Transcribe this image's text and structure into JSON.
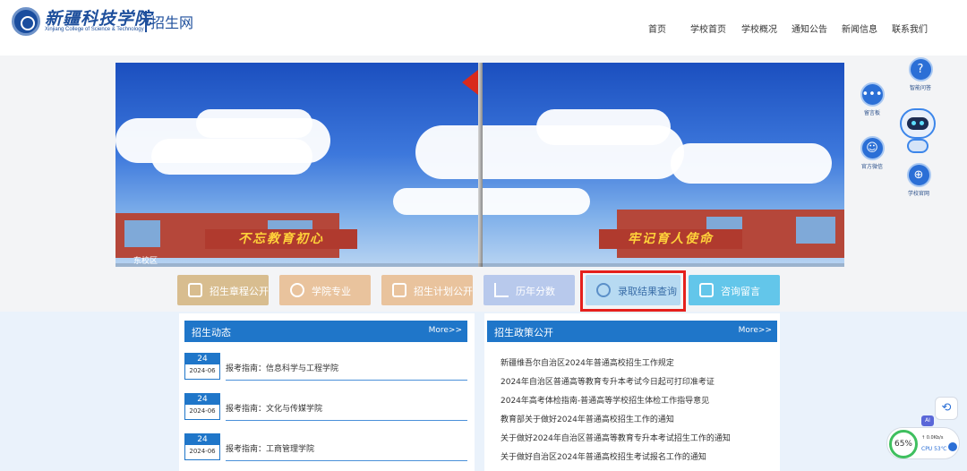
{
  "header": {
    "logo_cn": "新疆科技学院",
    "logo_en": "Xinjiang College of Science & Technology",
    "site_name": "招生网",
    "nav": [
      "首页",
      "学校首页",
      "学校概况",
      "通知公告",
      "新闻信息",
      "联系我们"
    ]
  },
  "banner": {
    "caption": "东校区",
    "slogan_left": "不忘教育初心",
    "slogan_right": "牢记育人使命"
  },
  "floating": {
    "items": [
      {
        "label": "智能问答",
        "icon": "question-icon"
      },
      {
        "label": "留言板",
        "icon": "chat-icon"
      },
      {
        "label": "官方微信",
        "icon": "wechat-icon"
      },
      {
        "label": "学校官网",
        "icon": "globe-icon"
      }
    ]
  },
  "quick_links": [
    {
      "label": "招生章程公开",
      "color": "#d8bd8f",
      "icon": "document-icon"
    },
    {
      "label": "学院专业",
      "color": "#e9c39d",
      "icon": "group-icon"
    },
    {
      "label": "招生计划公开",
      "color": "#e9c39d",
      "icon": "edit-icon"
    },
    {
      "label": "历年分数",
      "color": "#b8c9ec",
      "icon": "chart-icon"
    },
    {
      "label": "录取结果查询",
      "color": "#b7daf2",
      "icon": "search-icon"
    },
    {
      "label": "咨询留言",
      "color": "#63c6ea",
      "icon": "message-icon"
    }
  ],
  "news": {
    "title": "招生动态",
    "more": "More>>",
    "items": [
      {
        "day": "24",
        "ym": "2024-06",
        "title": "报考指南：信息科学与工程学院"
      },
      {
        "day": "24",
        "ym": "2024-06",
        "title": "报考指南：文化与传媒学院"
      },
      {
        "day": "24",
        "ym": "2024-06",
        "title": "报考指南：工商管理学院"
      }
    ]
  },
  "policy": {
    "title": "招生政策公开",
    "more": "More>>",
    "items": [
      "新疆维吾尔自治区2024年普通高校招生工作规定",
      "2024年自治区普通高等教育专升本考试今日起可打印准考证",
      "2024年高考体检指南-普通高等学校招生体检工作指导意见",
      "教育部关于做好2024年普通高校招生工作的通知",
      "关于做好2024年自治区普通高等教育专升本考试招生工作的通知",
      "关于做好自治区2024年普通高校招生考试报名工作的通知"
    ]
  },
  "system": {
    "ai_label": "AI",
    "cpu_percent": "65%",
    "net_speed": "↑ 0.0Kb/s",
    "cpu_temp": "CPU 53℃"
  }
}
